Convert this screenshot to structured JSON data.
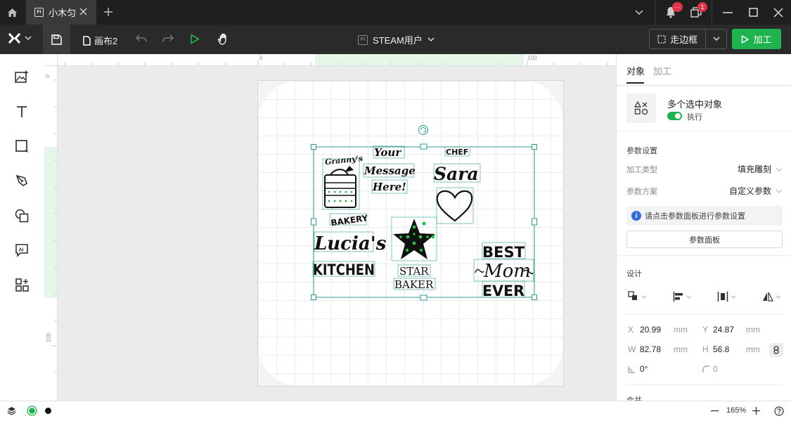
{
  "titlebar": {
    "tab_label": "小木匀",
    "tab_icon_text": "FI",
    "notification_badge": "···",
    "window_badge": "1"
  },
  "toolbar": {
    "document_name": "画布2",
    "user_label": "STEAM用户",
    "user_icon_text": "FI",
    "frame_label": "走边框",
    "process_label": "加工"
  },
  "leftbar": {
    "items": [
      "add-image",
      "text",
      "shape",
      "pen",
      "combine",
      "ai",
      "apps"
    ]
  },
  "rulers": {
    "top_labels": [
      "0",
      "100"
    ],
    "left_labels": [
      "0",
      "100"
    ]
  },
  "design": {
    "texts": {
      "grannys": "Granny's",
      "your": "Your",
      "message": "Message",
      "here": "Here!",
      "chef": "CHEF",
      "sara": "Sara",
      "bakery": "BAKERY",
      "lucias": "Lucia's",
      "kitchen": "KITCHEN",
      "star": "STAR",
      "baker": "BAKER",
      "best": "BEST",
      "mom": "Mom",
      "ever": "EVER"
    }
  },
  "right_panel": {
    "tabs": [
      "对象",
      "加工"
    ],
    "object_title": "多个选中对象",
    "toggle_label": "执行",
    "params_title": "参数设置",
    "process_type_label": "加工类型",
    "process_type_value": "填充雕刻",
    "param_scheme_label": "参数方案",
    "param_scheme_value": "自定义参数",
    "info_text": "请点击参数面板进行参数设置",
    "panel_button": "参数面板",
    "design_title": "设计",
    "x_label": "X",
    "x_value": "20.99",
    "y_label": "Y",
    "y_value": "24.87",
    "w_label": "W",
    "w_value": "82.78",
    "h_label": "H",
    "h_value": "56.8",
    "unit": "mm",
    "rotation": "0°",
    "corner": "0",
    "merge_label": "合并"
  },
  "statusbar": {
    "zoom": "165%"
  },
  "colors": {
    "accent_green": "#1fb34f",
    "selection": "#2a9d8f",
    "badge_red": "#e0304a"
  }
}
